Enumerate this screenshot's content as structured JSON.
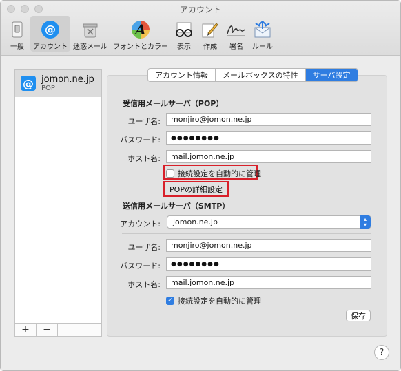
{
  "window": {
    "title": "アカウント"
  },
  "toolbar": {
    "items": [
      {
        "label": "一般",
        "icon": "general-switch-icon"
      },
      {
        "label": "アカウント",
        "icon": "at-sign-icon",
        "selected": true
      },
      {
        "label": "迷惑メール",
        "icon": "junk-trash-icon"
      },
      {
        "label": "フォントとカラー",
        "icon": "font-color-icon"
      },
      {
        "label": "表示",
        "icon": "glasses-icon"
      },
      {
        "label": "作成",
        "icon": "pencil-compose-icon"
      },
      {
        "label": "署名",
        "icon": "signature-icon"
      },
      {
        "label": "ルール",
        "icon": "rules-envelope-icon"
      }
    ]
  },
  "sidebar": {
    "account": {
      "name": "jomon.ne.jp",
      "type": "POP",
      "icon": "@"
    },
    "add_label": "+",
    "remove_label": "−"
  },
  "tabs": [
    {
      "label": "アカウント情報",
      "active": false
    },
    {
      "label": "メールボックスの特性",
      "active": false
    },
    {
      "label": "サーバ設定",
      "active": true
    }
  ],
  "incoming": {
    "title": "受信用メールサーバ（POP）",
    "username_label": "ユーザ名:",
    "username": "monjiro@jomon.ne.jp",
    "password_label": "パスワード:",
    "password": "●●●●●●●●",
    "host_label": "ホスト名:",
    "host": "mail.jomon.ne.jp",
    "auto_manage_label": "接続設定を自動的に管理",
    "auto_manage_checked": false,
    "advanced_button": "POPの詳細設定"
  },
  "outgoing": {
    "title": "送信用メールサーバ（SMTP）",
    "account_label": "アカウント:",
    "account": "jomon.ne.jp",
    "username_label": "ユーザ名:",
    "username": "monjiro@jomon.ne.jp",
    "password_label": "パスワード:",
    "password": "●●●●●●●●",
    "host_label": "ホスト名:",
    "host": "mail.jomon.ne.jp",
    "auto_manage_label": "接続設定を自動的に管理",
    "auto_manage_checked": true
  },
  "save_button": "保存",
  "help_button": "?",
  "colors": {
    "accent": "#2f7de1",
    "highlight": "#d8202a"
  }
}
